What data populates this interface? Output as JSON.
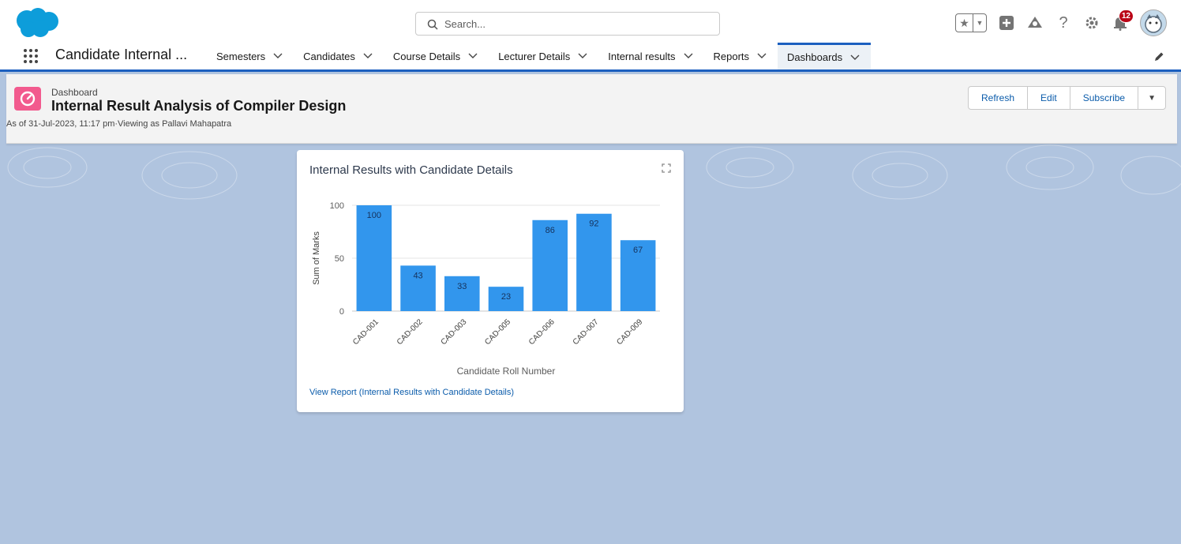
{
  "header": {
    "search_placeholder": "Search...",
    "notification_count": "12"
  },
  "nav": {
    "app_name": "Candidate Internal ...",
    "items": [
      {
        "label": "Semesters"
      },
      {
        "label": "Candidates"
      },
      {
        "label": "Course Details"
      },
      {
        "label": "Lecturer Details"
      },
      {
        "label": "Internal results"
      },
      {
        "label": "Reports"
      },
      {
        "label": "Dashboards"
      }
    ]
  },
  "page_header": {
    "object_label": "Dashboard",
    "title": "Internal Result Analysis of Compiler Design",
    "subtitle": "As of 31-Jul-2023, 11:17 pm·Viewing as Pallavi Mahapatra",
    "buttons": {
      "refresh": "Refresh",
      "edit": "Edit",
      "subscribe": "Subscribe"
    }
  },
  "card": {
    "title": "Internal Results with Candidate Details",
    "view_report": "View Report (Internal Results with Candidate Details)"
  },
  "chart_data": {
    "type": "bar",
    "categories": [
      "CAD-001",
      "CAD-002",
      "CAD-003",
      "CAD-005",
      "CAD-006",
      "CAD-007",
      "CAD-009"
    ],
    "values": [
      100,
      43,
      33,
      23,
      86,
      92,
      67
    ],
    "xlabel": "Candidate Roll Number",
    "ylabel": "Sum of Marks",
    "ylim": [
      0,
      100
    ],
    "yticks": [
      0,
      50,
      100
    ],
    "grid": true,
    "bar_color": "#3296ed"
  },
  "colors": {
    "accent": "#1b5fbf",
    "link": "#0b5cab",
    "dashboard_icon": "#f25a8e",
    "background": "#b0c4df"
  }
}
